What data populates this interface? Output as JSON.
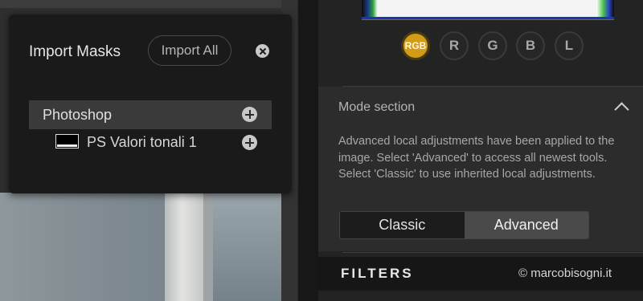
{
  "popup": {
    "title": "Import Masks",
    "import_all_label": "Import All",
    "close_icon": "close-icon",
    "group": {
      "label": "Photoshop",
      "icon": "plus-circle-icon"
    },
    "masks": [
      {
        "label": "PS Valori tonali 1",
        "icon": "plus-circle-icon"
      }
    ]
  },
  "channels": [
    {
      "label": "RGB",
      "active": true
    },
    {
      "label": "R",
      "active": false
    },
    {
      "label": "G",
      "active": false
    },
    {
      "label": "B",
      "active": false
    },
    {
      "label": "L",
      "active": false
    }
  ],
  "mode_section": {
    "title": "Mode section",
    "description": "Advanced local adjustments have been applied to the image. Select 'Advanced' to access all newest tools. Select 'Classic' to use inherited local adjustments.",
    "options": [
      "Classic",
      "Advanced"
    ],
    "selected": "Advanced"
  },
  "filters": {
    "title": "FILTERS",
    "watermark": "© marcobisogni.it"
  },
  "colors": {
    "accent": "#d39c17",
    "panel_bg": "#232323",
    "popup_bg": "#1a1a1a"
  }
}
